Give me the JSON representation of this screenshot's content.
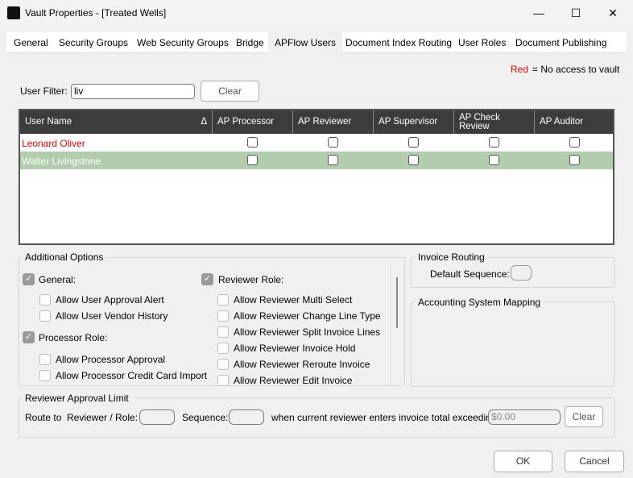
{
  "window": {
    "title": "Vault Properties - [Treated Wells]",
    "minimize": "—",
    "maximize": "☐",
    "close": "✕"
  },
  "tabs": [
    "General",
    "Security Groups",
    "Web Security Groups",
    "Bridge",
    "APFlow Users",
    "Document Index Routing",
    "User Roles",
    "Document Publishing"
  ],
  "active_tab": "APFlow Users",
  "legend": {
    "red": "Red",
    "text": "= No access to vault",
    "red_color": "#e00000"
  },
  "filter": {
    "label": "User Filter:",
    "value": "liv",
    "clear": "Clear"
  },
  "grid": {
    "columns": [
      "User Name",
      "AP Processor",
      "AP Reviewer",
      "AP Supervisor",
      "AP Check Review",
      "AP Auditor"
    ],
    "sort_indicator": "Δ",
    "rows": [
      {
        "name": "Leonard Oliver",
        "no_access": true,
        "checks": [
          false,
          false,
          false,
          false,
          false
        ]
      },
      {
        "name": "Walter Livingstone",
        "selected": true,
        "checks": [
          false,
          false,
          false,
          false,
          false
        ]
      }
    ],
    "selected_color": "#b2cdae"
  },
  "additional": {
    "title": "Additional Options",
    "general": {
      "label": "General:",
      "checked": true,
      "items": [
        "Allow User Approval Alert",
        "Allow User Vendor History"
      ]
    },
    "processor": {
      "label": "Processor Role:",
      "checked": true,
      "items": [
        "Allow Processor Approval",
        "Allow Processor Credit Card Import"
      ]
    },
    "reviewer": {
      "label": "Reviewer Role:",
      "checked": true,
      "items": [
        "Allow Reviewer Multi Select",
        "Allow Reviewer Change Line Type",
        "Allow Reviewer Split Invoice Lines",
        "Allow Reviewer Invoice Hold",
        "Allow Reviewer Reroute Invoice",
        "Allow Reviewer Edit Invoice"
      ]
    }
  },
  "invoice_routing": {
    "title": "Invoice Routing",
    "default_sequence": "Default Sequence:"
  },
  "accounting": {
    "title": "Accounting System Mapping"
  },
  "approval": {
    "title": "Reviewer Approval Limit",
    "route_to": "Route to",
    "reviewer_role": "Reviewer / Role:",
    "sequence": "Sequence:",
    "exceeding": "when current reviewer enters invoice total exceeding:",
    "amount": "$0.00",
    "clear": "Clear"
  },
  "footer": {
    "ok": "OK",
    "cancel": "Cancel"
  }
}
